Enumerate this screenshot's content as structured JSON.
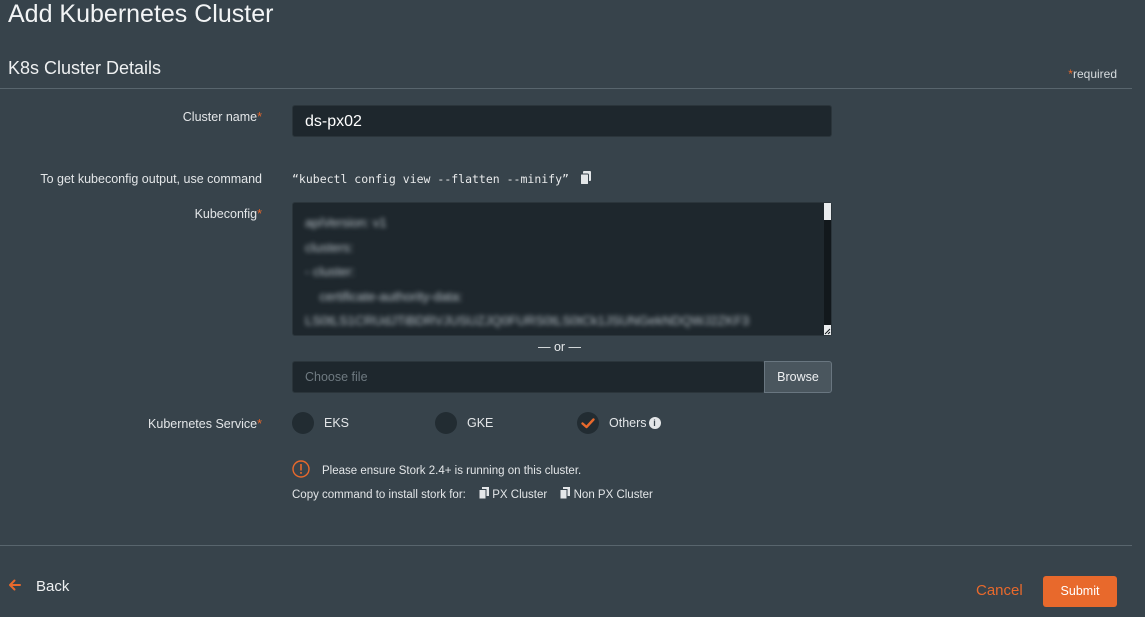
{
  "page": {
    "title": "Add Kubernetes Cluster"
  },
  "section": {
    "title": "K8s Cluster Details",
    "required_star": "*",
    "required_label": "required"
  },
  "form": {
    "cluster_name": {
      "label": "Cluster name",
      "star": "*",
      "value": "ds-px02"
    },
    "kubeconfig_hint": {
      "label": "To get kubeconfig output, use command",
      "command": "“kubectl config view --flatten --minify”"
    },
    "kubeconfig": {
      "label": "Kubeconfig",
      "star": "*",
      "lines": [
        "apiVersion: v1",
        "clusters:",
        "- cluster:",
        "    certificate-authority-data:",
        "LS0tLS1CRUdJTiBDRVJUSUZJQ0FURS0tLS0tCk1JSUNGekNDQWJ2ZKF3"
      ]
    },
    "or_separator": "— or —",
    "file": {
      "placeholder": "Choose file",
      "browse_label": "Browse"
    },
    "service": {
      "label": "Kubernetes Service",
      "star": "*",
      "options": [
        {
          "label": "EKS",
          "selected": false
        },
        {
          "label": "GKE",
          "selected": false
        },
        {
          "label": "Others",
          "selected": true
        }
      ]
    },
    "stork_notice": "Please ensure Stork 2.4+ is running on this cluster.",
    "copy_command": {
      "label": "Copy command to install stork for:",
      "px_cluster": "PX Cluster",
      "non_px_cluster": "Non PX Cluster"
    }
  },
  "footer": {
    "back_label": "Back",
    "cancel_label": "Cancel",
    "submit_label": "Submit"
  },
  "colors": {
    "accent": "#e8692c",
    "background": "#37434b",
    "input_bg": "#1e272d"
  }
}
